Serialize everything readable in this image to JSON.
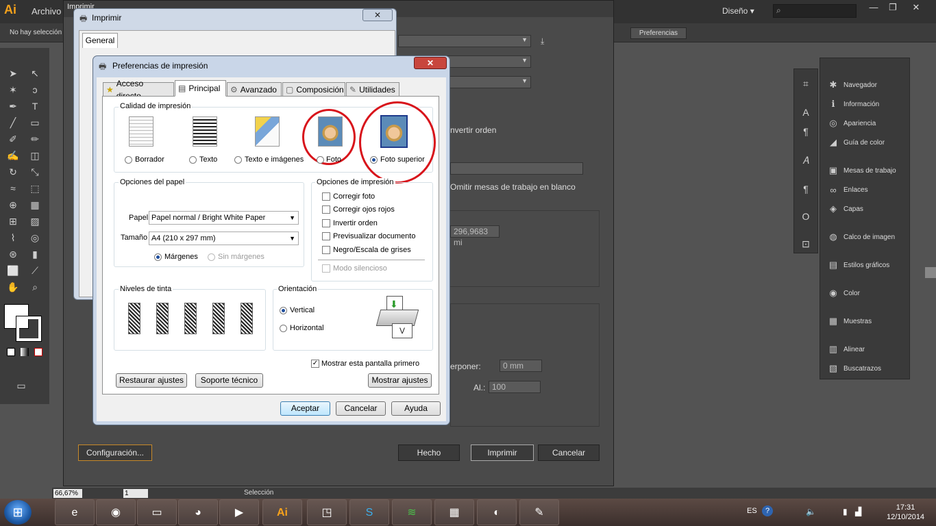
{
  "app": {
    "logo": "Ai",
    "menu_archivo": "Archivo",
    "workspace": "Diseño ▾",
    "no_selection": "No hay selección",
    "preferences_btn": "Preferencias",
    "window_controls": [
      "—",
      "❐",
      "✕"
    ]
  },
  "right_panel": {
    "items": [
      {
        "icon": "✱",
        "label": "Navegador"
      },
      {
        "icon": "ℹ",
        "label": "Información"
      },
      {
        "icon": "◎",
        "label": "Apariencia"
      },
      {
        "icon": "◢",
        "label": "Guía de color"
      },
      {
        "icon": "▣",
        "label": "Mesas de trabajo"
      },
      {
        "icon": "∞",
        "label": "Enlaces"
      },
      {
        "icon": "◈",
        "label": "Capas"
      },
      {
        "icon": "◍",
        "label": "Calco de imagen"
      },
      {
        "icon": "▤",
        "label": "Estilos gráficos"
      },
      {
        "icon": "◉",
        "label": "Color"
      },
      {
        "icon": "▦",
        "label": "Muestras"
      },
      {
        "icon": "▥",
        "label": "Alinear"
      },
      {
        "icon": "▧",
        "label": "Buscatrazos"
      }
    ]
  },
  "statusbar": {
    "zoom": "66,67%",
    "page": "1",
    "selection": "Selección"
  },
  "ai_print": {
    "title": "Imprimir",
    "invert_order": "nvertir orden",
    "omit_artboards": "Omitir mesas de trabajo en blanco",
    "width_value": "296,9683 mi",
    "overlap_label": "erponer:",
    "overlap_value": "0 mm",
    "height_label": "Al.:",
    "height_value": "100",
    "setup_btn": "Configuración...",
    "done_btn": "Hecho",
    "print_btn": "Imprimir",
    "cancel_btn": "Cancelar"
  },
  "win_print": {
    "title": "Imprimir",
    "tab_general": "General",
    "close": "✕"
  },
  "prefs": {
    "title": "Preferencias de impresión",
    "close": "✕",
    "tabs": [
      "Acceso directo",
      "Principal",
      "Avanzado",
      "Composición",
      "Utilidades"
    ],
    "tab_icons": [
      "★",
      "▤",
      "⚙",
      "▢",
      "✎"
    ],
    "quality": {
      "label": "Calidad de impresión",
      "options": [
        "Borrador",
        "Texto",
        "Texto e imágenes",
        "Foto",
        "Foto superior"
      ],
      "selected": "Foto superior"
    },
    "paper": {
      "label": "Opciones del papel",
      "paper_label": "Papel",
      "paper_value": "Papel normal / Bright White Paper",
      "size_label": "Tamaño",
      "size_value": "A4 (210 x 297 mm)",
      "margins": "Márgenes",
      "no_margins": "Sin márgenes"
    },
    "print_opts": {
      "label": "Opciones de impresión",
      "items": [
        "Corregir foto",
        "Corregir ojos rojos",
        "Invertir orden",
        "Previsualizar documento",
        "Negro/Escala de grises"
      ],
      "quiet": "Modo silencioso"
    },
    "ink": {
      "label": "Niveles de tinta"
    },
    "orientation": {
      "label": "Orientación",
      "vertical": "Vertical",
      "horizontal": "Horizontal",
      "selected": "Vertical"
    },
    "show_first": "Mostrar esta pantalla primero",
    "restore_btn": "Restaurar ajustes",
    "support_btn": "Soporte técnico",
    "show_settings_btn": "Mostrar ajustes",
    "ok_btn": "Aceptar",
    "cancel_btn": "Cancelar",
    "help_btn": "Ayuda"
  },
  "taskbar": {
    "start": "⊞",
    "apps": [
      {
        "icon": "e",
        "name": "ie-icon"
      },
      {
        "icon": "◉",
        "name": "chrome-icon"
      },
      {
        "icon": "▭",
        "name": "explorer-icon"
      },
      {
        "icon": "◕",
        "name": "firefox-icon"
      },
      {
        "icon": "▶",
        "name": "media-icon"
      },
      {
        "icon": "Ai",
        "name": "illustrator-icon"
      },
      {
        "icon": "◳",
        "name": "app-icon"
      },
      {
        "icon": "S",
        "name": "skype-icon"
      },
      {
        "icon": "≋",
        "name": "spotify-icon"
      },
      {
        "icon": "▦",
        "name": "control-icon"
      },
      {
        "icon": "◐",
        "name": "app2-icon"
      },
      {
        "icon": "✎",
        "name": "paint-icon"
      }
    ],
    "lang": "ES",
    "time": "17:31",
    "date": "12/10/2014"
  }
}
